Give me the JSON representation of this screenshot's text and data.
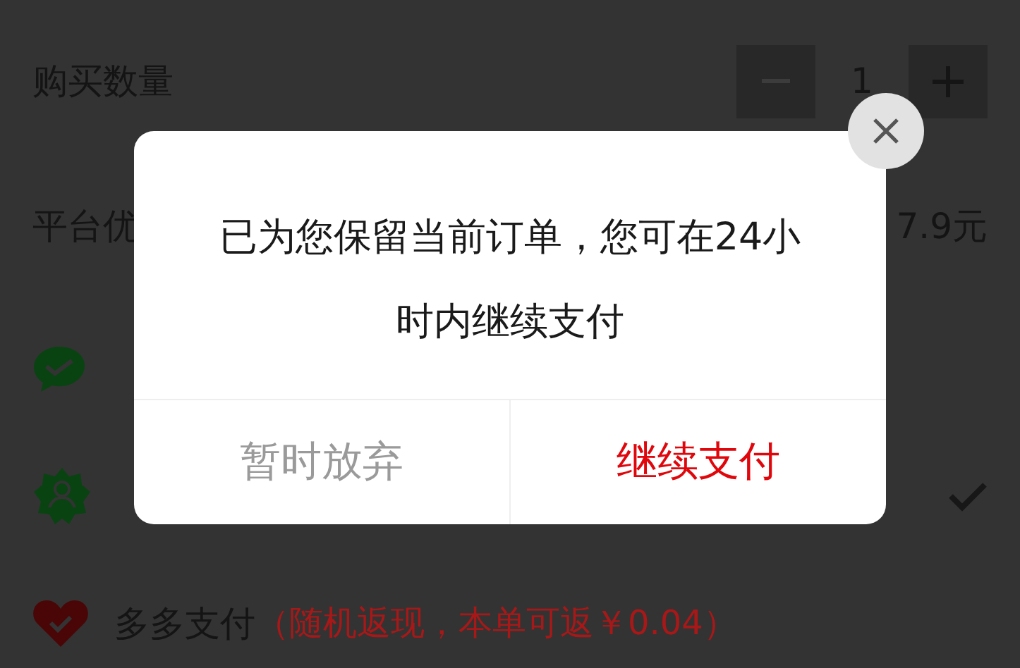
{
  "quantity": {
    "label": "购买数量",
    "value": "1"
  },
  "discount": {
    "label": "平台优",
    "amount": "7.9元"
  },
  "payment_methods": [
    {
      "kind": "wechat",
      "selected": false
    },
    {
      "kind": "member",
      "selected": true
    },
    {
      "kind": "heart",
      "label": "多多支付",
      "note": "（随机返现，本单可返￥0.04）",
      "selected": false
    }
  ],
  "dialog": {
    "message": "已为您保留当前订单，您可在24小时内继续支付",
    "buttons": [
      {
        "label": "暂时放弃",
        "kind": "secondary"
      },
      {
        "label": "继续支付",
        "kind": "primary"
      }
    ]
  }
}
